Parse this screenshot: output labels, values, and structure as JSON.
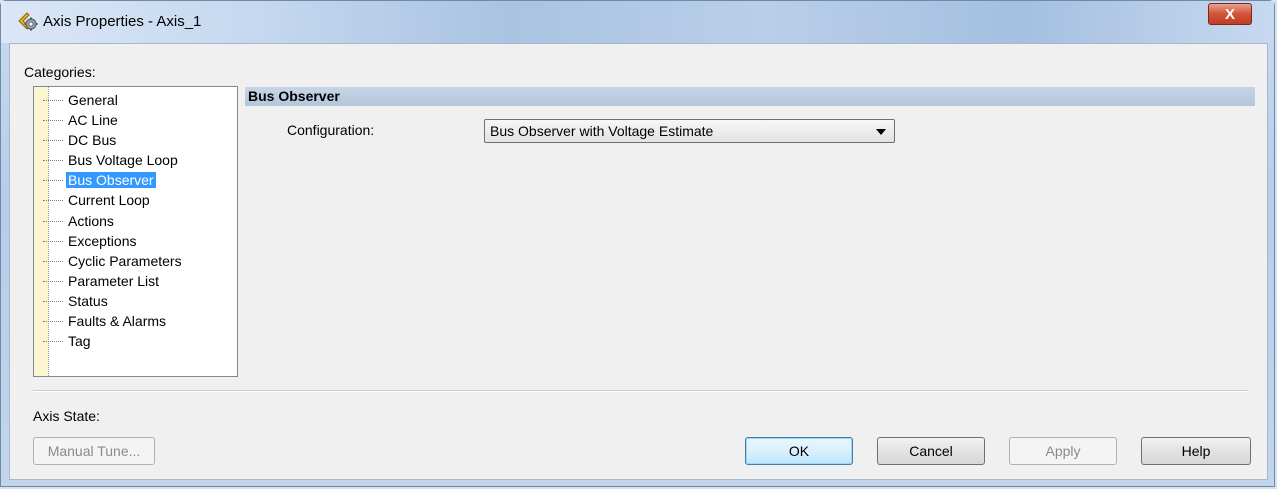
{
  "window": {
    "title": "Axis Properties - Axis_1",
    "close_label": "X"
  },
  "categories": {
    "label": "Categories:",
    "items": [
      {
        "label": "General"
      },
      {
        "label": "AC Line"
      },
      {
        "label": "DC Bus"
      },
      {
        "label": "Bus Voltage Loop"
      },
      {
        "label": "Bus Observer"
      },
      {
        "label": "Current Loop"
      },
      {
        "label": "Actions"
      },
      {
        "label": "Exceptions"
      },
      {
        "label": "Cyclic Parameters"
      },
      {
        "label": "Parameter List"
      },
      {
        "label": "Status"
      },
      {
        "label": "Faults & Alarms"
      },
      {
        "label": "Tag"
      }
    ],
    "selected": "Bus Observer"
  },
  "panel": {
    "header": "Bus Observer",
    "configuration_label": "Configuration:",
    "configuration_value": "Bus Observer with Voltage Estimate"
  },
  "footer": {
    "axis_state_label": "Axis State:",
    "manual_tune_label": "Manual Tune...",
    "ok_label": "OK",
    "cancel_label": "Cancel",
    "apply_label": "Apply",
    "help_label": "Help"
  },
  "colors": {
    "selection": "#3399ff",
    "header_band": "#b3c6dc",
    "close_button": "#c13c22"
  },
  "icons": {
    "title": "axis-gear-icon",
    "close": "close-icon",
    "dropdown": "chevron-down-icon"
  }
}
